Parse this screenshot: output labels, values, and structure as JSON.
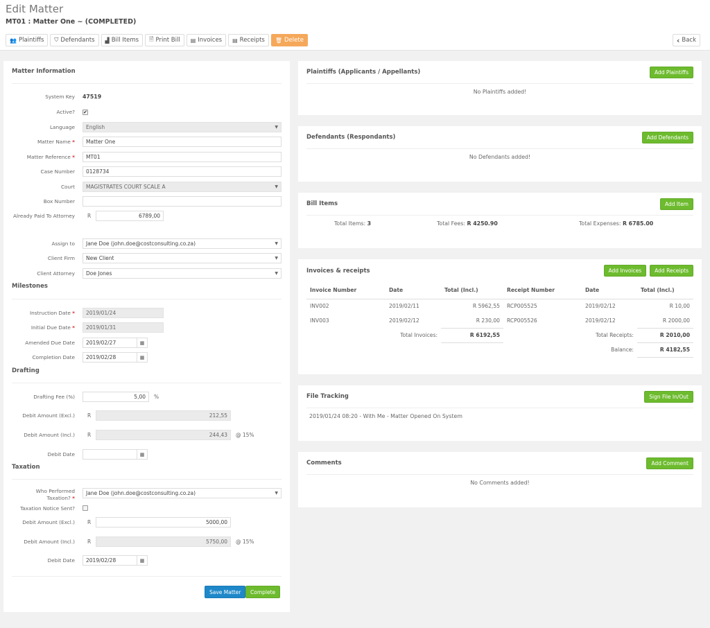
{
  "header": {
    "title": "Edit Matter",
    "subtitle": "MT01 : Matter One ~ (COMPLETED)",
    "toolbar": [
      {
        "label": "Plaintiffs",
        "icon": "users-icon",
        "glyph": "👥"
      },
      {
        "label": "Defendants",
        "icon": "shield-icon",
        "glyph": "⛉"
      },
      {
        "label": "Bill Items",
        "icon": "chart-area-icon",
        "glyph": "▟"
      },
      {
        "label": "Print Bill",
        "icon": "file-text-icon",
        "glyph": "🗎"
      },
      {
        "label": "Invoices",
        "icon": "list-alt-icon",
        "glyph": "▤"
      },
      {
        "label": "Receipts",
        "icon": "list-alt-icon",
        "glyph": "▤"
      },
      {
        "label": "Delete",
        "icon": "trash-icon",
        "glyph": "🗑"
      }
    ],
    "back_label": "Back",
    "back_glyph": "‹"
  },
  "matter_info": {
    "title": "Matter Information",
    "system_key_label": "System Key",
    "system_key": "47519",
    "active_label": "Active?",
    "active_checked": true,
    "language_label": "Language",
    "language": "English",
    "matter_name_label": "Matter Name",
    "matter_name": "Matter One",
    "matter_ref_label": "Matter Reference",
    "matter_ref": "MT01",
    "case_number_label": "Case Number",
    "case_number": "0128734",
    "court_label": "Court",
    "court": "MAGISTRATES COURT SCALE A",
    "box_number_label": "Box Number",
    "box_number": "",
    "already_paid_label": "Already Paid To Attorney",
    "currency": "R",
    "already_paid": "6789,00",
    "assign_to_label": "Assign to",
    "assign_to": "Jane Doe (john.doe@costconsulting.co.za)",
    "client_firm_label": "Client Firm",
    "client_firm": "New Client",
    "client_attorney_label": "Client Attorney",
    "client_attorney": "Doe Jones",
    "required_mark": "*",
    "caret": "▼",
    "calendar_glyph": "▦"
  },
  "milestones": {
    "title": "Milestones",
    "instruction_date_label": "Instruction Date",
    "instruction_date": "2019/01/24",
    "initial_due_label": "Initial Due Date",
    "initial_due": "2019/01/31",
    "amended_due_label": "Amended Due Date",
    "amended_due": "2019/02/27",
    "completion_label": "Completion Date",
    "completion": "2019/02/28"
  },
  "drafting": {
    "title": "Drafting",
    "fee_label": "Drafting Fee (%)",
    "fee": "5,00",
    "fee_suffix": "%",
    "debit_excl_label": "Debit Amount (Excl.)",
    "debit_excl": "212,55",
    "debit_incl_label": "Debit Amount (Incl.)",
    "debit_incl": "244,43",
    "vat_suffix": "@ 15%",
    "debit_date_label": "Debit Date",
    "debit_date": ""
  },
  "taxation": {
    "title": "Taxation",
    "performed_by_label_1": "Who Performed",
    "performed_by_label_2": "Taxation?",
    "performed_by": "Jane Doe (john.doe@costconsulting.co.za)",
    "notice_sent_label": "Taxation Notice Sent?",
    "notice_sent": false,
    "debit_excl_label": "Debit Amount (Excl.)",
    "debit_excl": "5000,00",
    "debit_incl_label": "Debit Amount (Incl.)",
    "debit_incl": "5750,00",
    "vat_suffix": "@ 15%",
    "debit_date_label": "Debit Date",
    "debit_date": "2019/02/28"
  },
  "form_actions": {
    "save_label": "Save Matter",
    "complete_label": "Complete"
  },
  "plaintiffs": {
    "title": "Plaintiffs (Applicants / Appellants)",
    "add_label": "Add Plaintiffs",
    "empty": "No Plaintiffs added!"
  },
  "defendants": {
    "title": "Defendants (Respondants)",
    "add_label": "Add Defendants",
    "empty": "No Defendants added!"
  },
  "bill_items": {
    "title": "Bill Items",
    "add_label": "Add Item",
    "total_items_label": "Total Items:",
    "total_items": "3",
    "total_fees_label": "Total Fees:",
    "total_fees": "R 4250.90",
    "total_expenses_label": "Total Expenses:",
    "total_expenses": "R 6785.00"
  },
  "invoices": {
    "title": "Invoices & receipts",
    "add_invoices_label": "Add Invoices",
    "add_receipts_label": "Add Receipts",
    "columns": [
      "Invoice Number",
      "Date",
      "Total (Incl.)",
      "Receipt Number",
      "Date",
      "Total (Incl.)"
    ],
    "rows": [
      [
        "INV002",
        "2019/02/11",
        "R 5962,55",
        "RCP005525",
        "2019/02/12",
        "R 10,00"
      ],
      [
        "INV003",
        "2019/02/12",
        "R 230,00",
        "RCP005526",
        "2019/02/12",
        "R 2000,00"
      ]
    ],
    "total_invoices_label": "Total Invoices:",
    "total_invoices": "R 6192,55",
    "total_receipts_label": "Total Receipts:",
    "total_receipts": "R 2010,00",
    "balance_label": "Balance:",
    "balance": "R 4182,55"
  },
  "file_tracking": {
    "title": "File Tracking",
    "action_label": "Sign File In/Out",
    "entries": [
      "2019/01/24 08:20 - With Me - Matter Opened On System"
    ]
  },
  "comments": {
    "title": "Comments",
    "add_label": "Add Comment",
    "empty": "No Comments added!"
  }
}
